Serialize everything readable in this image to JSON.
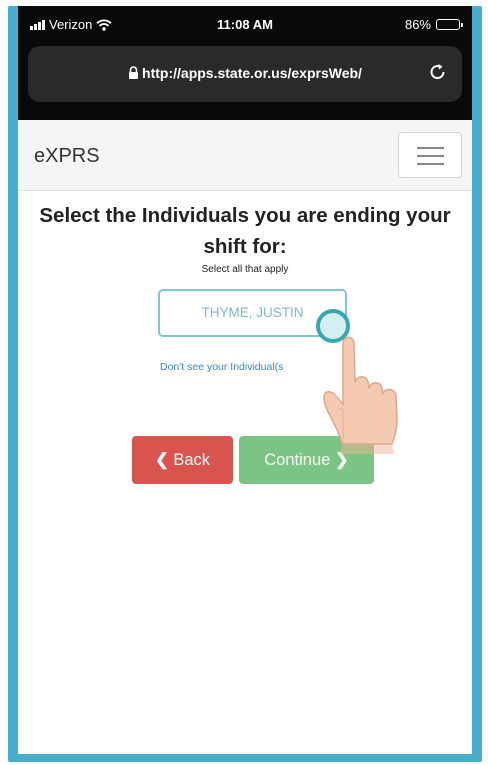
{
  "status_bar": {
    "carrier": "Verizon",
    "time": "11:08 AM",
    "battery": "86%",
    "battery_level": 0.86
  },
  "browser": {
    "url": "http://apps.state.or.us/exprsWeb/"
  },
  "navbar": {
    "brand": "eXPRS"
  },
  "page": {
    "heading": "Select the Individuals you are ending your shift for:",
    "hint": "Select all that apply",
    "individual": "THYME, JUSTIN",
    "missing_link": "Don't see your Individual(s",
    "back_label": "Back",
    "continue_label": "Continue"
  },
  "icons": {
    "signal": "signal-bars-icon",
    "wifi": "wifi-icon",
    "battery": "battery-icon",
    "lock": "lock-icon",
    "reload": "reload-icon",
    "menu": "hamburger-menu-icon",
    "back": "chevron-left-icon",
    "continue": "chevron-right-icon",
    "pointer": "tapping-hand-icon"
  },
  "colors": {
    "frame": "#47afc9",
    "back_button": "#d9534f",
    "continue_button": "#7cc483",
    "link": "#3a86c8",
    "individual_border": "#7fc7d6"
  }
}
